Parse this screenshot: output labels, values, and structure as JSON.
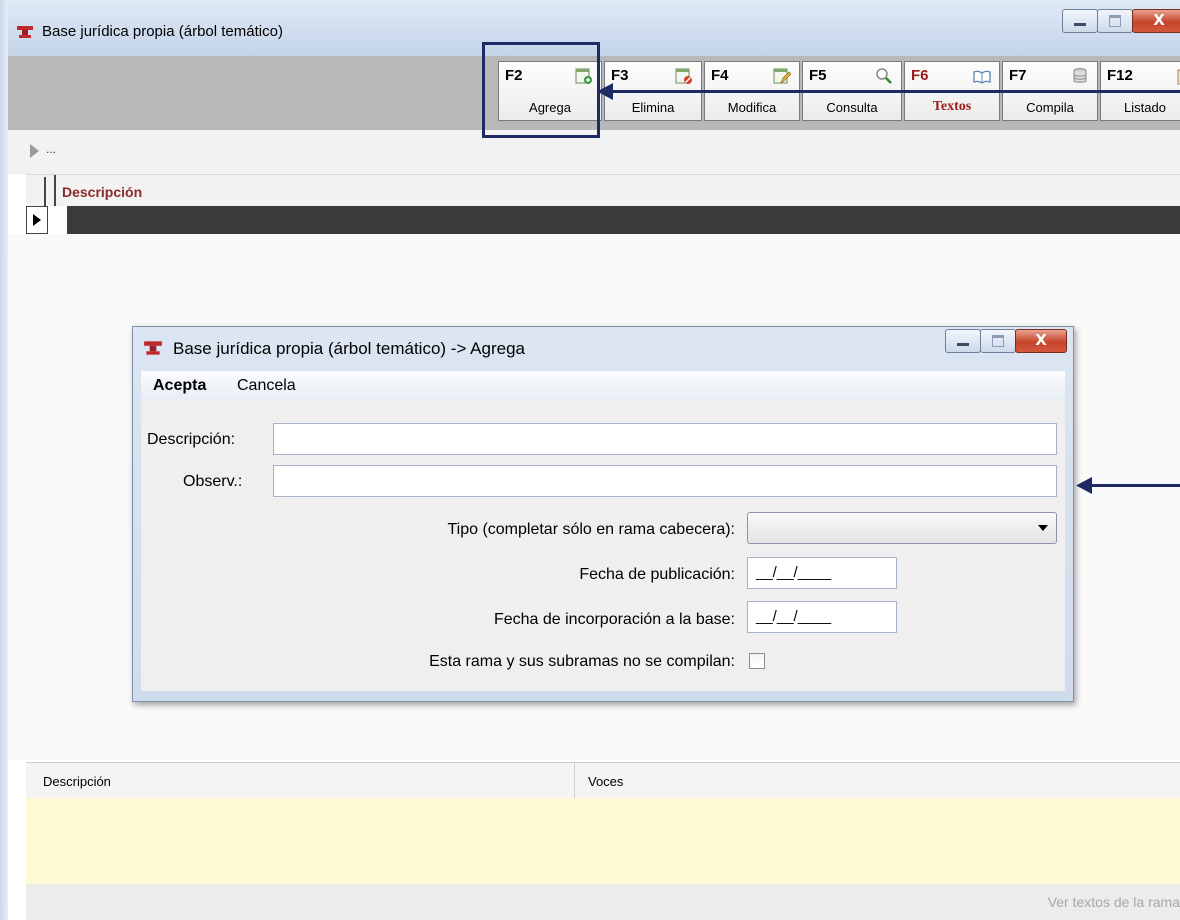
{
  "main_window": {
    "title": "Base jurídica propia (árbol temático)",
    "toolbar": [
      {
        "key": "F2",
        "label": "Agrega",
        "icon": "add-doc-icon"
      },
      {
        "key": "F3",
        "label": "Elimina",
        "icon": "delete-doc-icon"
      },
      {
        "key": "F4",
        "label": "Modifica",
        "icon": "edit-doc-icon"
      },
      {
        "key": "F5",
        "label": "Consulta",
        "icon": "magnifier-icon"
      },
      {
        "key": "F6",
        "label": "Textos",
        "icon": "book-icon"
      },
      {
        "key": "F7",
        "label": "Compila",
        "icon": "database-icon"
      },
      {
        "key": "F12",
        "label": "Listado",
        "icon": "clipboard-icon"
      }
    ],
    "nav_text": "...",
    "grid": {
      "column": "Descripción"
    },
    "bottom": {
      "col1": "Descripción",
      "col2": "Voces",
      "status_link": "Ver textos de la rama"
    }
  },
  "dialog": {
    "title": "Base jurídica propia (árbol temático) -> Agrega",
    "menu": {
      "accept": "Acepta",
      "cancel": "Cancela"
    },
    "fields": {
      "descripcion_label": "Descripción:",
      "descripcion_value": "",
      "observ_label": "Observ.:",
      "observ_value": "",
      "tipo_label": "Tipo (completar sólo en rama cabecera):",
      "tipo_value": "",
      "fecha_pub_label": "Fecha de publicación:",
      "fecha_pub_value": "__/__/____",
      "fecha_inc_label": "Fecha de incorporación a la base:",
      "fecha_inc_value": "__/__/____",
      "no_compila_label": "Esta rama y sus subramas no se compilan:"
    }
  },
  "colors": {
    "annotation": "#1e2a63",
    "accent_red": "#9b1a1a",
    "yellow_panel": "#fefbd4"
  }
}
